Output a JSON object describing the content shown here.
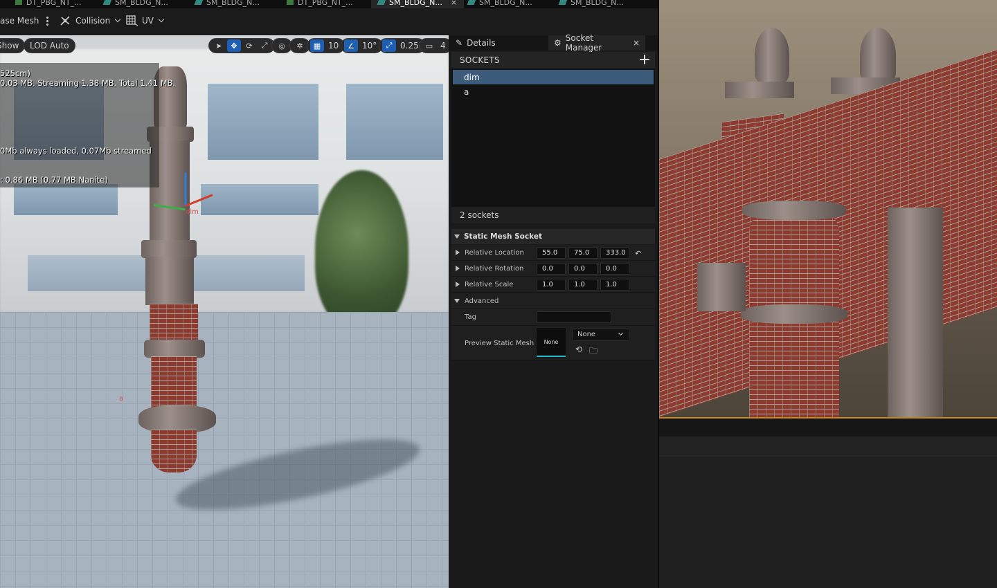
{
  "tabs": [
    {
      "label": "DT_PBG_NT_...",
      "icon": "datatable-icon"
    },
    {
      "label": "SM_BLDG_N...",
      "icon": "static-mesh-icon"
    },
    {
      "label": "SM_BLDG_N...",
      "icon": "static-mesh-icon"
    },
    {
      "label": "DT_PBG_NT_...",
      "icon": "datatable-icon"
    },
    {
      "label": "SM_BLDG_N...",
      "icon": "static-mesh-icon",
      "active": true
    },
    {
      "label": "SM_BLDG_N...",
      "icon": "static-mesh-icon"
    },
    {
      "label": "SM_BLDG_N...",
      "icon": "static-mesh-icon"
    }
  ],
  "toolbar": {
    "base_mesh_label": "ase Mesh",
    "collision_label": "Collision",
    "uv_label": "UV"
  },
  "viewport": {
    "show_label": "Show",
    "lod_label": "LOD Auto",
    "grid_snap": "10",
    "rotation_snap": "10°",
    "scale_snap": "0.25",
    "camera_speed": "4",
    "stats": [
      "525cm)",
      "0.03 MB. Streaming 1.38 MB. Total 1.41 MB.",
      "0Mb always loaded, 0.07Mb streamed",
      ": 0.86 MB (0.77 MB Nanite)"
    ],
    "socket_labels": [
      "dim",
      "a"
    ]
  },
  "details": {
    "tab_details": "Details",
    "tab_socket_manager": "Socket Manager",
    "sockets_header": "SOCKETS",
    "sockets": [
      "dim",
      "a"
    ],
    "selected_socket": "dim",
    "socket_count": "2 sockets",
    "section_title": "Static Mesh Socket",
    "relative_location": {
      "label": "Relative Location",
      "x": "55.0",
      "y": "75.0",
      "z": "333.0"
    },
    "relative_rotation": {
      "label": "Relative Rotation",
      "x": "0.0",
      "y": "0.0",
      "z": "0.0"
    },
    "relative_scale": {
      "label": "Relative Scale",
      "x": "1.0",
      "y": "1.0",
      "z": "1.0"
    },
    "advanced_label": "Advanced",
    "tag_label": "Tag",
    "tag_value": "",
    "preview_label": "Preview Static Mesh",
    "preview_thumb_text": "None",
    "preview_value": "None"
  },
  "colors": {
    "accent_blue": "#1e5fb4",
    "selection": "#3c5a7a",
    "thumb_underline": "#26b5c8",
    "viewport_border": "#c58a1e"
  }
}
